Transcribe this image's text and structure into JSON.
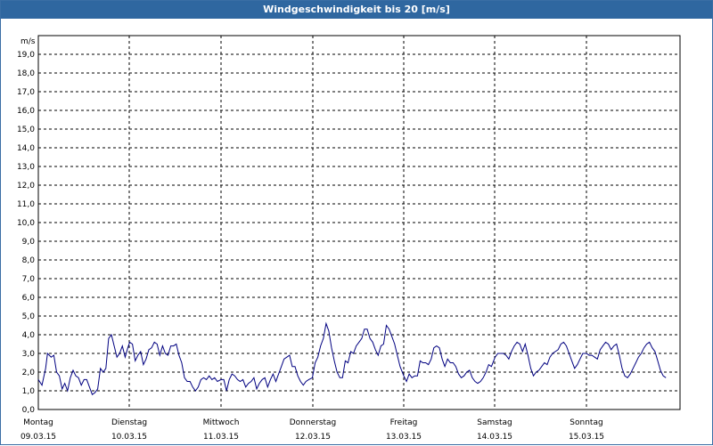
{
  "window": {
    "title": "Windgeschwindigkeit bis 20 [m/s]"
  },
  "chart_data": {
    "type": "line",
    "title": "Windgeschwindigkeit bis 20 [m/s]",
    "xlabel": "",
    "ylabel": "m/s",
    "ylim": [
      0,
      20
    ],
    "y_ticks": [
      "0,0",
      "1,0",
      "2,0",
      "3,0",
      "4,0",
      "5,0",
      "6,0",
      "7,0",
      "8,0",
      "9,0",
      "10,0",
      "11,0",
      "12,0",
      "13,0",
      "14,0",
      "15,0",
      "16,0",
      "17,0",
      "18,0",
      "19,0"
    ],
    "x_days": [
      {
        "day": "Montag",
        "date": "09.03.15"
      },
      {
        "day": "Dienstag",
        "date": "10.03.15"
      },
      {
        "day": "Mittwoch",
        "date": "11.03.15"
      },
      {
        "day": "Donnerstag",
        "date": "12.03.15"
      },
      {
        "day": "Freitag",
        "date": "13.03.15"
      },
      {
        "day": "Samstag",
        "date": "14.03.15"
      },
      {
        "day": "Sonntag",
        "date": "15.03.15"
      }
    ],
    "grid": true,
    "line_color": "#000080",
    "series": [
      {
        "x_day_offsets": [
          0.0,
          0.04,
          0.08,
          0.1,
          0.14,
          0.17,
          0.2,
          0.23,
          0.26,
          0.29,
          0.32,
          0.35,
          0.38,
          0.41,
          0.44,
          0.47,
          0.5,
          0.53,
          0.56,
          0.59,
          0.62,
          0.65,
          0.68,
          0.71,
          0.74,
          0.77,
          0.8,
          0.83,
          0.86,
          0.89,
          0.92,
          0.95,
          0.98,
          1.0,
          1.03,
          1.06,
          1.09,
          1.12,
          1.15,
          1.18,
          1.21,
          1.24,
          1.27,
          1.3,
          1.33,
          1.36,
          1.39,
          1.42,
          1.45,
          1.48,
          1.51,
          1.54,
          1.57,
          1.6,
          1.63,
          1.66,
          1.69,
          1.72,
          1.75,
          1.78,
          1.81,
          1.84,
          1.87,
          1.9,
          1.93,
          1.96,
          2.0,
          2.03,
          2.06,
          2.09,
          2.12,
          2.15,
          2.18,
          2.21,
          2.24,
          2.27,
          2.3,
          2.33,
          2.36,
          2.39,
          2.42,
          2.45,
          2.48,
          2.51,
          2.54,
          2.57,
          2.6,
          2.63,
          2.66,
          2.69,
          2.72,
          2.75,
          2.78,
          2.81,
          2.84,
          2.87,
          2.9,
          2.93,
          2.96,
          3.0,
          3.03,
          3.06,
          3.09,
          3.12,
          3.15,
          3.18,
          3.21,
          3.24,
          3.27,
          3.3,
          3.33,
          3.36,
          3.39,
          3.42,
          3.45,
          3.48,
          3.51,
          3.54,
          3.57,
          3.6,
          3.63,
          3.66,
          3.69,
          3.72,
          3.75,
          3.78,
          3.81,
          3.84,
          3.87,
          3.9,
          3.93,
          3.96,
          4.0,
          4.03,
          4.06,
          4.09,
          4.12,
          4.15,
          4.18,
          4.21,
          4.24,
          4.27,
          4.3,
          4.33,
          4.36,
          4.39,
          4.42,
          4.45,
          4.48,
          4.51,
          4.54,
          4.57,
          4.6,
          4.63,
          4.66,
          4.69,
          4.72,
          4.75,
          4.78,
          4.81,
          4.84,
          4.87,
          4.9,
          4.93,
          4.96,
          5.0,
          5.03,
          5.06,
          5.09,
          5.12,
          5.15,
          5.18,
          5.21,
          5.24,
          5.27,
          5.3,
          5.33,
          5.36,
          5.39,
          5.42,
          5.45,
          5.48,
          5.51,
          5.54,
          5.57,
          5.6,
          5.63,
          5.66,
          5.69,
          5.72,
          5.75,
          5.78,
          5.81,
          5.84,
          5.87,
          5.9,
          5.93,
          5.96,
          6.0,
          6.03,
          6.06,
          6.09,
          6.12,
          6.15,
          6.18,
          6.21,
          6.24,
          6.27,
          6.3,
          6.33,
          6.36,
          6.39,
          6.42,
          6.45,
          6.48,
          6.51,
          6.54,
          6.57,
          6.6,
          6.63,
          6.66,
          6.69,
          6.72,
          6.75,
          6.78,
          6.81,
          6.84,
          6.87,
          6.9,
          6.93,
          6.96,
          6.99
        ],
        "values": [
          1.6,
          1.3,
          2.2,
          3.0,
          2.8,
          2.9,
          2.0,
          1.8,
          1.1,
          1.4,
          1.0,
          1.7,
          2.1,
          1.8,
          1.7,
          1.3,
          1.6,
          1.6,
          1.2,
          0.8,
          0.9,
          1.1,
          2.2,
          2.0,
          2.2,
          3.8,
          4.0,
          3.4,
          2.8,
          3.0,
          3.4,
          2.8,
          3.3,
          3.6,
          3.5,
          2.6,
          2.9,
          3.1,
          2.4,
          2.7,
          3.2,
          3.3,
          3.6,
          3.5,
          2.9,
          3.4,
          3.0,
          2.9,
          3.4,
          3.4,
          3.5,
          2.9,
          2.5,
          1.7,
          1.5,
          1.5,
          1.2,
          1.0,
          1.2,
          1.6,
          1.7,
          1.6,
          1.8,
          1.6,
          1.7,
          1.5,
          1.6,
          1.6,
          1.0,
          1.6,
          1.9,
          1.8,
          1.6,
          1.5,
          1.6,
          1.2,
          1.4,
          1.5,
          1.7,
          1.1,
          1.4,
          1.6,
          1.7,
          1.2,
          1.6,
          1.9,
          1.5,
          1.9,
          2.3,
          2.7,
          2.8,
          2.9,
          2.3,
          2.3,
          1.8,
          1.5,
          1.3,
          1.5,
          1.6,
          1.7,
          2.5,
          2.8,
          3.4,
          3.8,
          4.6,
          4.2,
          3.3,
          2.6,
          2.0,
          1.7,
          1.7,
          2.6,
          2.5,
          3.1,
          3.0,
          3.4,
          3.6,
          3.8,
          4.3,
          4.3,
          3.8,
          3.6,
          3.2,
          2.9,
          3.4,
          3.5,
          4.5,
          4.3,
          3.9,
          3.5,
          2.9,
          2.3,
          1.8,
          1.5,
          1.9,
          1.7,
          1.8,
          1.8,
          2.6,
          2.5,
          2.5,
          2.4,
          2.7,
          3.3,
          3.4,
          3.3,
          2.7,
          2.3,
          2.7,
          2.5,
          2.5,
          2.3,
          1.9,
          1.7,
          1.8,
          2.0,
          2.1,
          1.7,
          1.5,
          1.4,
          1.5,
          1.7,
          2.0,
          2.4,
          2.3,
          2.8,
          3.0,
          3.0,
          3.0,
          2.9,
          2.7,
          3.1,
          3.4,
          3.6,
          3.5,
          3.1,
          3.5,
          2.9,
          2.2,
          1.8,
          2.0,
          2.1,
          2.3,
          2.5,
          2.4,
          2.8,
          3.0,
          3.1,
          3.2,
          3.5,
          3.6,
          3.4,
          3.0,
          2.6,
          2.2,
          2.4,
          2.7,
          3.0,
          3.0,
          2.9,
          2.9,
          2.8,
          2.7,
          3.2,
          3.4,
          3.6,
          3.5,
          3.2,
          3.4,
          3.5,
          2.9,
          2.2,
          1.8,
          1.7,
          1.9,
          2.2,
          2.5,
          2.8,
          3.0,
          3.3,
          3.5,
          3.6,
          3.3,
          3.1,
          2.6,
          2.1,
          1.8,
          1.7
        ]
      }
    ]
  }
}
